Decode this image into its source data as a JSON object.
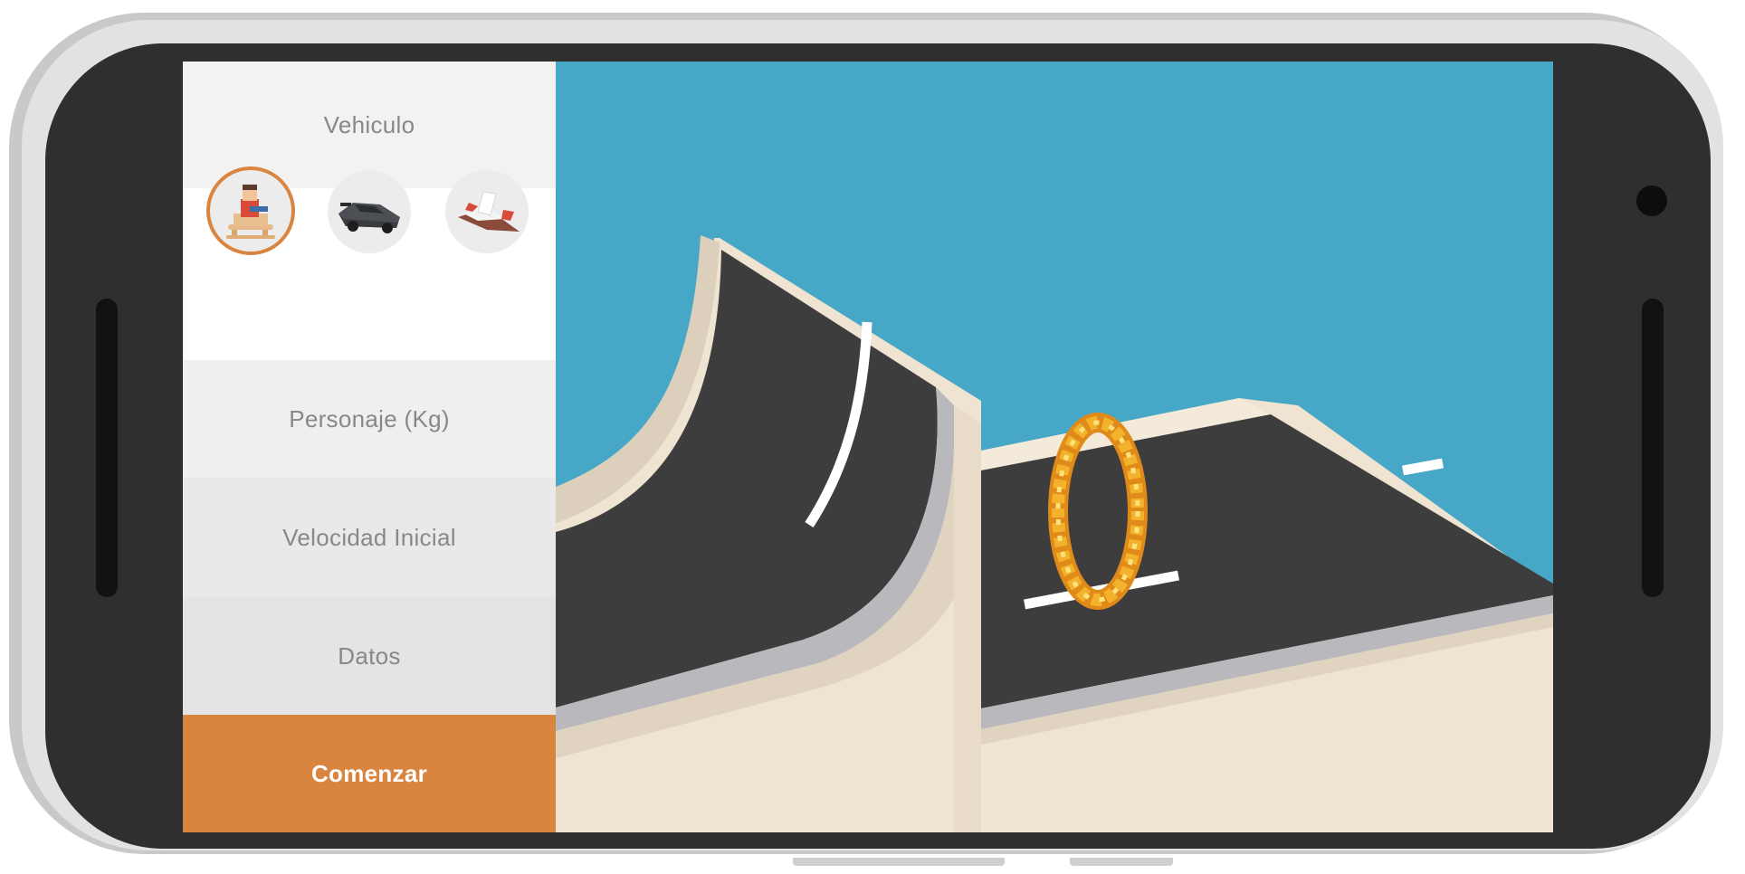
{
  "panel": {
    "vehicle_header": "Vehiculo",
    "vehicles": [
      {
        "icon": "sled-rider-icon",
        "selected": true
      },
      {
        "icon": "car-icon",
        "selected": false
      },
      {
        "icon": "airplane-icon",
        "selected": false
      }
    ],
    "character_label": "Personaje (Kg)",
    "initial_speed_label": "Velocidad Inicial",
    "data_label": "Datos",
    "start_button": "Comenzar"
  },
  "colors": {
    "sky": "#47a7c6",
    "road": "#3d3d3d",
    "sand": "#efe3d1",
    "accent": "#d9843f",
    "fire_ring": "#f2b22c"
  }
}
